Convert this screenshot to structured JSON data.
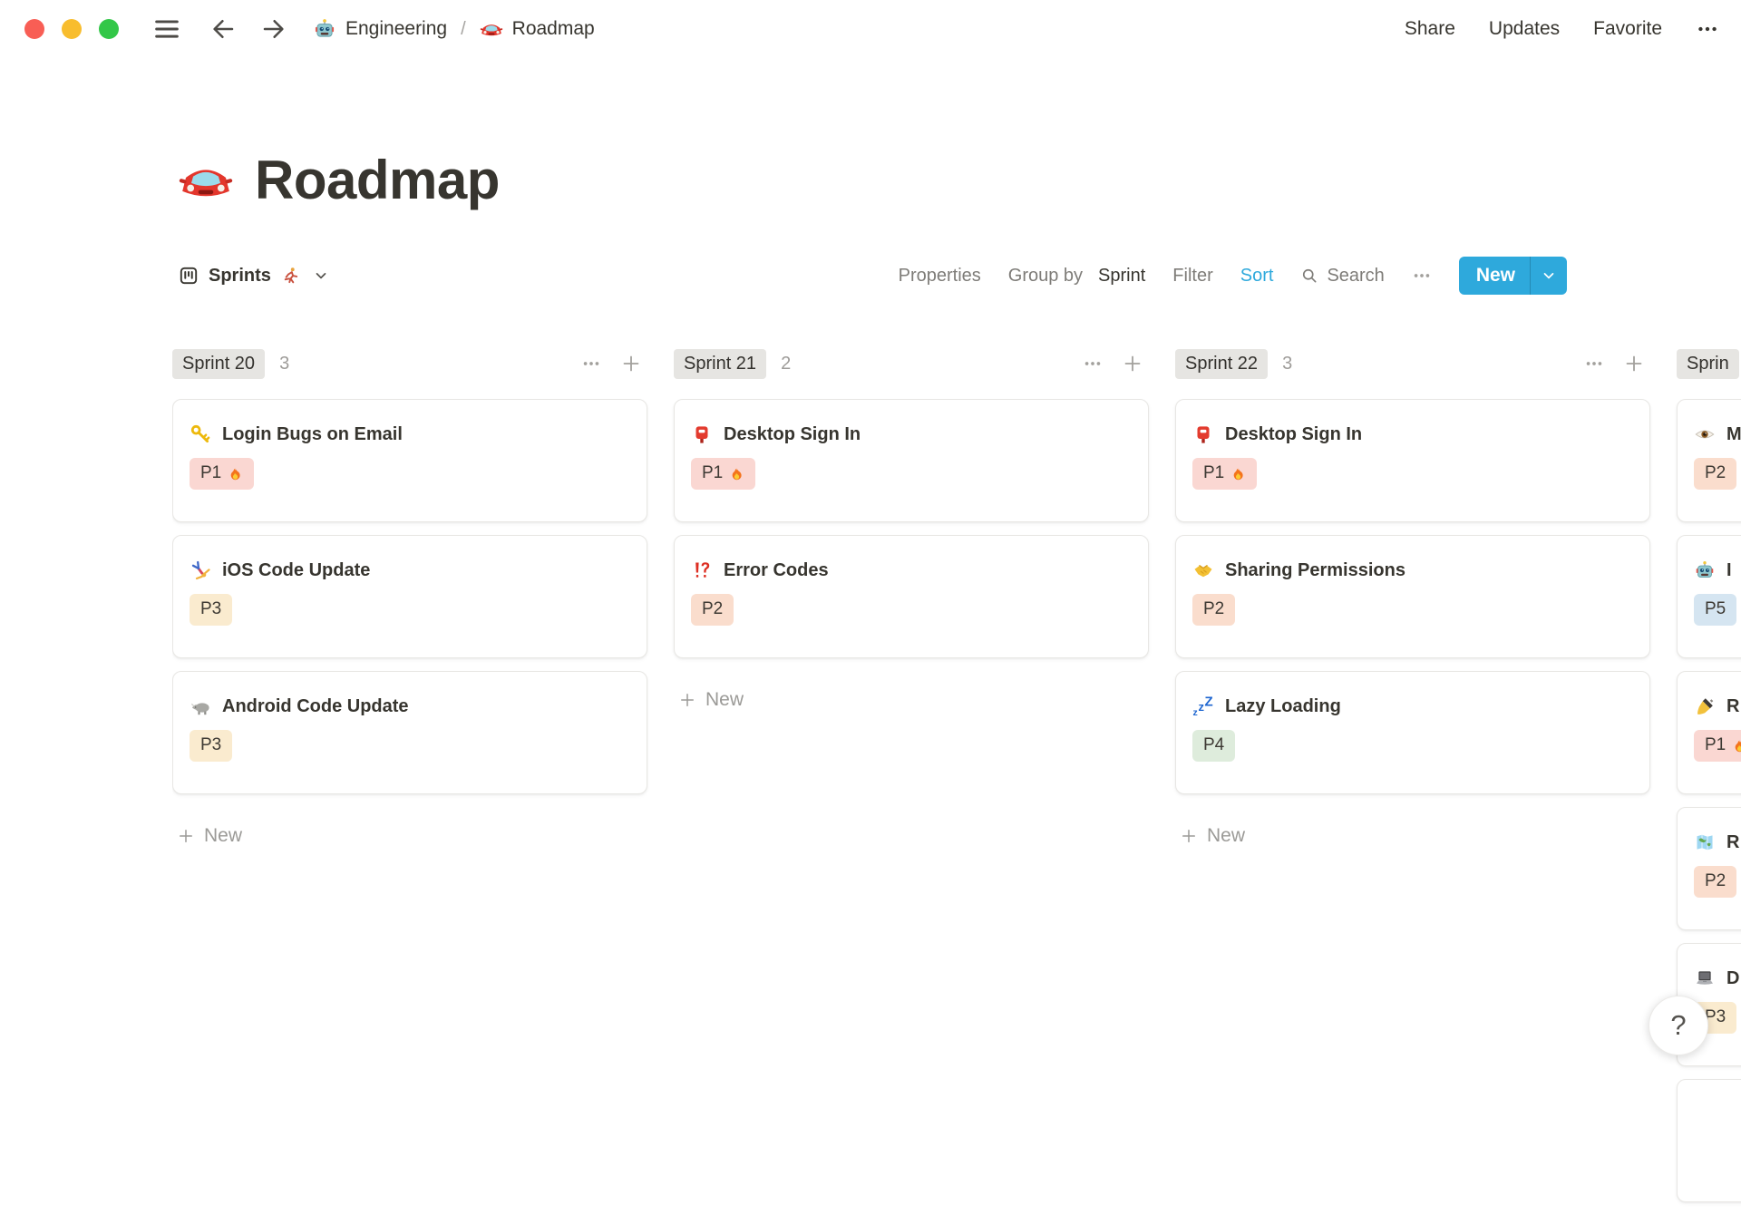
{
  "topbar": {
    "breadcrumb": [
      {
        "icon": "robot",
        "label": "Engineering"
      },
      {
        "icon": "oncoming-car",
        "label": "Roadmap"
      }
    ],
    "breadcrumb_divider": "/",
    "actions": [
      "Share",
      "Updates",
      "Favorite"
    ]
  },
  "page": {
    "icon": "oncoming-car",
    "title": "Roadmap"
  },
  "toolbar": {
    "view_icon": "board",
    "view_label": "Sprints",
    "view_emoji": "runner",
    "properties_label": "Properties",
    "group_by_label": "Group by",
    "group_by_value": "Sprint",
    "filter_label": "Filter",
    "sort_label": "Sort",
    "search_label": "Search",
    "new_label": "New"
  },
  "board": {
    "columns": [
      {
        "name": "Sprint 20",
        "count": "3",
        "new_label": "New",
        "cards": [
          {
            "icon": "key",
            "title": "Login Bugs on Email",
            "badge": {
              "label": "P1",
              "emoji": "fire",
              "color": "red"
            }
          },
          {
            "icon": "cartwheel",
            "title": "iOS Code Update",
            "badge": {
              "label": "P3",
              "color": "yellow"
            }
          },
          {
            "icon": "rhinoceros",
            "title": "Android Code Update",
            "badge": {
              "label": "P3",
              "color": "yellow"
            }
          }
        ]
      },
      {
        "name": "Sprint 21",
        "count": "2",
        "new_label": "New",
        "cards": [
          {
            "icon": "postbox",
            "title": "Desktop Sign In",
            "badge": {
              "label": "P1",
              "emoji": "fire",
              "color": "red"
            }
          },
          {
            "icon": "bangbang",
            "title": "Error Codes",
            "badge": {
              "label": "P2",
              "color": "orange"
            }
          }
        ]
      },
      {
        "name": "Sprint 22",
        "count": "3",
        "new_label": "New",
        "cards": [
          {
            "icon": "postbox",
            "title": "Desktop Sign In",
            "badge": {
              "label": "P1",
              "emoji": "fire",
              "color": "red"
            }
          },
          {
            "icon": "handshake",
            "title": "Sharing Permissions",
            "badge": {
              "label": "P2",
              "color": "orange"
            }
          },
          {
            "icon": "zzz",
            "title": "Lazy Loading",
            "badge": {
              "label": "P4",
              "color": "green"
            }
          }
        ]
      },
      {
        "name": "Sprin",
        "count": "",
        "clipped": true,
        "cards": [
          {
            "icon": "eye",
            "title": "M",
            "badge": {
              "label": "P2",
              "color": "orange"
            }
          },
          {
            "icon": "robot",
            "title": "I",
            "badge": {
              "label": "P5",
              "color": "blue"
            }
          },
          {
            "icon": "writing-hand",
            "title": "R",
            "badge": {
              "label": "P1",
              "emoji": "fire",
              "color": "red"
            }
          },
          {
            "icon": "world-map",
            "title": "R",
            "badge": {
              "label": "P2",
              "color": "orange"
            }
          },
          {
            "icon": "laptop",
            "title": "D",
            "badge": {
              "label": "P3",
              "color": "yellow"
            }
          },
          {
            "partial": true
          }
        ]
      }
    ]
  },
  "help_button": {
    "label": "?"
  },
  "colors": {
    "accent": "#2EA9DC",
    "pill": "#E6E5E2",
    "badge_red": "#FAD7D2",
    "badge_orange": "#FADDCD",
    "badge_yellow": "#FAEBCF",
    "badge_green": "#DEECDC",
    "badge_blue": "#D5E5F1",
    "traffic_red": "#F85E55",
    "traffic_yellow": "#F8BD2E",
    "traffic_green": "#33C748"
  }
}
